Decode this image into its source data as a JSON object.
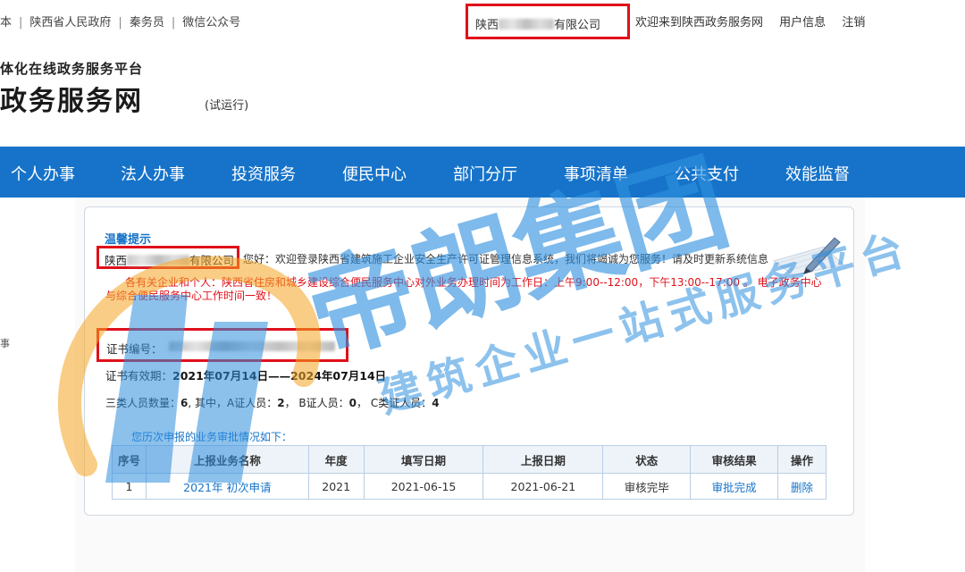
{
  "topbar": {
    "links": [
      "本",
      "陕西省人民政府",
      "秦务员",
      "微信公众号"
    ],
    "company_prefix": "陕西",
    "company_suffix": "有限公司",
    "welcome": "欢迎来到陕西政务服务网",
    "user_info": "用户信息",
    "logout": "注销"
  },
  "brand": {
    "subtitle": "体化在线政务服务平台",
    "title": "政务服务网",
    "trial": "(试运行)"
  },
  "nav": {
    "items": [
      "个人办事",
      "法人办事",
      "投资服务",
      "便民中心",
      "部门分厅",
      "事项清单",
      "公共支付",
      "效能监督"
    ]
  },
  "side": {
    "mark": "事"
  },
  "tip": {
    "title": "温馨提示",
    "company_prefix": "陕西",
    "company_suffix": "有限公司",
    "welcome": "您好：欢迎登录陕西省建筑施工企业安全生产许可证管理信息系统，我们将竭诚为您服务！请及时更新系统信息",
    "notice": "各有关企业和个人：陕西省住房和城乡建设综合便民服务中心对外业务办理时间为工作日：上午9:00--12:00，下午13:00--17:00 。 电子政务中心与综合便民服务中心工作时间一致！"
  },
  "cert": {
    "label": "证书编号：",
    "validity_label": "证书有效期：",
    "validity_value": "2021年07月14日——2024年07月14日",
    "staff_label": "三类人员数量：",
    "staff_total": "6",
    "staff_mid": ", 其中，A证人员：",
    "staff_a": "2",
    "staff_b_label": "， B证人员：",
    "staff_b": "0",
    "staff_c_label": "， C类证人员：",
    "staff_c": "4"
  },
  "history": {
    "title": "您历次申报的业务审批情况如下：",
    "columns": [
      "序号",
      "上报业务名称",
      "年度",
      "填写日期",
      "上报日期",
      "状态",
      "审核结果",
      "操作"
    ],
    "rows": [
      [
        "1",
        "2021年 初次申请",
        "2021",
        "2021-06-15",
        "2021-06-21",
        "审核完毕",
        "审批完成",
        "删除"
      ]
    ]
  },
  "watermark": {
    "main": "帝朗集团",
    "sub": "建筑企业一站式服务平台"
  },
  "colors": {
    "nav_blue": "#1673c9",
    "highlight_red": "#e0101a",
    "watermark_blue": "#2f8fde",
    "watermark_orange": "#f5a623"
  }
}
